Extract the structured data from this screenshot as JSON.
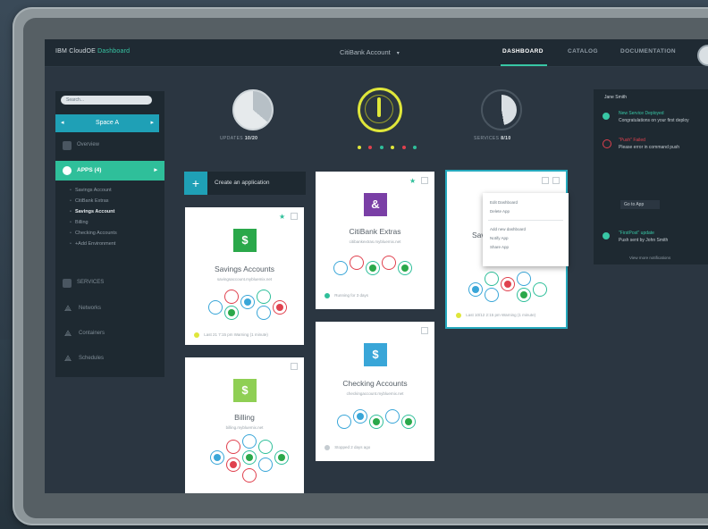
{
  "topbar": {
    "brand": "IBM CloudOE",
    "brand_accent": "Dashboard",
    "context": "CitiBank Account",
    "nav": [
      "DASHBOARD",
      "CATALOG",
      "DOCUMENTATION"
    ]
  },
  "sidebar": {
    "search_placeholder": "Search...",
    "space": "Space A",
    "overview": "Overview",
    "apps_label": "APPS (4)",
    "apps": [
      "Savings Account",
      "CitiBank Extras",
      "Savings Account",
      "Billing",
      "Checking Accounts",
      "+Add Environment"
    ],
    "services": "SERVICES",
    "lower": [
      "Networks",
      "Containers",
      "Schedules"
    ]
  },
  "dials": {
    "left_label": "UPDATES",
    "left_value": "10/20",
    "right_label": "SERVICES",
    "right_value": "8/10"
  },
  "create_label": "Create an application",
  "cards": [
    {
      "name": "Savings Accounts",
      "sub": "savingsaccount.mybluemix.net",
      "icon": "$",
      "foot": "Last 21 7:15 pm Warning (1 minute)"
    },
    {
      "name": "CitiBank Extras",
      "sub": "citibankextras.mybluemix.net",
      "icon": "&",
      "foot": "Running for 3 days"
    },
    {
      "name": "Savings",
      "sub": "",
      "icon": "$",
      "foot": "Last 10/12 2:15 pm Warning (1 minute)"
    },
    {
      "name": "Billing",
      "sub": "billing.mybluemix.net",
      "icon": "$",
      "foot": ""
    },
    {
      "name": "Checking Accounts",
      "sub": "checkingaccount.mybluemix.net",
      "icon": "$",
      "foot": "Stopped 2 days ago"
    }
  ],
  "menu": [
    "Edit Dashboard",
    "Delete App",
    "Add new dashboard",
    "Notify App",
    "Share App"
  ],
  "notifications": {
    "user": "Jane Smith",
    "items": [
      {
        "title": "New Service Deployed",
        "text": "Congratulations on your first deploy"
      },
      {
        "title": "\"Push\" Failed",
        "text": "Please error in command push"
      },
      {
        "title": "\"FirstPost\" update",
        "text": "Push sent by John Smith"
      }
    ],
    "button": "Go to App",
    "footer": "View more notifications"
  },
  "colors": {
    "teal": "#1fa0b6",
    "green": "#2fbf9a",
    "yellow": "#dfe63a",
    "red": "#e0414e",
    "blue": "#39a6d8"
  }
}
